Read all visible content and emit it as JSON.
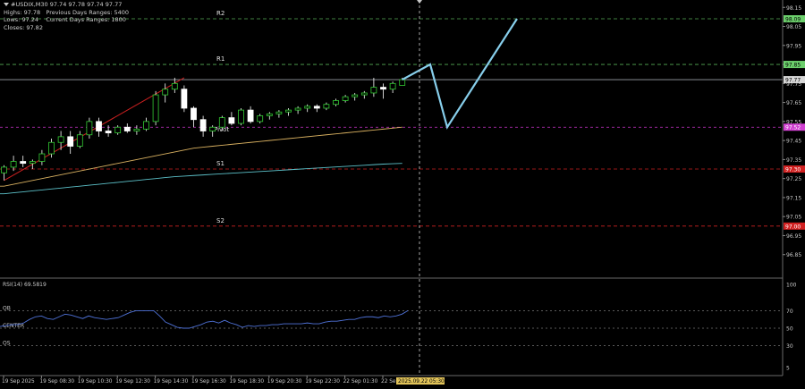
{
  "header": {
    "title": "#USDIX,M30 97.74 97.78 97.74 97.77",
    "high": "Highs: 97.78",
    "prev_range": "Previous Days Ranges: 5400",
    "low": "Lows: 97.24",
    "cur_range": "Current Days Ranges: 1800",
    "close": "Closes: 97.82"
  },
  "colors": {
    "background": "#000000",
    "bull": "#ffffff",
    "bear": "#ffffff",
    "wick": "#ffffff",
    "candle_outline": "#33cc33",
    "grid": "#3a3a3a",
    "resistance": "#55aa55",
    "support": "#cc2222",
    "pivot": "#cc33cc",
    "ma_fast": "#d8b060",
    "ma_slow": "#5cc0c8",
    "forecast": "#87ceeb",
    "rsi_line": "#4f72d8",
    "trend": "#cc2020"
  },
  "chart_data": [
    {
      "type": "candlestick",
      "symbol": "#USDIX",
      "timeframe": "M30",
      "ylim": [
        96.75,
        98.17
      ],
      "yticks": [
        98.15,
        98.05,
        97.95,
        97.85,
        97.75,
        97.65,
        97.55,
        97.45,
        97.35,
        97.25,
        97.15,
        97.05,
        96.95,
        96.85
      ],
      "xticks": [
        "19 Sep 2025",
        "19 Sep 08:30",
        "19 Sep 10:30",
        "19 Sep 12:30",
        "19 Sep 14:30",
        "19 Sep 16:30",
        "19 Sep 18:30",
        "19 Sep 20:30",
        "19 Sep 22:30",
        "22 Sep 01:30",
        "22 Se"
      ],
      "cursor_time": "2025.09.22 05:30",
      "levels": [
        {
          "name": "R2",
          "value": 98.09,
          "label": "98.09",
          "kind": "resistance"
        },
        {
          "name": "R1",
          "value": 97.85,
          "label": "97.85",
          "kind": "resistance"
        },
        {
          "name": "",
          "value": 97.77,
          "label": "97.77",
          "kind": "price"
        },
        {
          "name": "Pivot",
          "value": 97.52,
          "label": "97.52",
          "kind": "pivot"
        },
        {
          "name": "S1",
          "value": 97.3,
          "label": "97.30",
          "kind": "support"
        },
        {
          "name": "S2",
          "value": 97.0,
          "label": "97.00",
          "kind": "support"
        }
      ],
      "candles": [
        {
          "o": 97.28,
          "h": 97.32,
          "l": 97.24,
          "c": 97.31
        },
        {
          "o": 97.31,
          "h": 97.37,
          "l": 97.29,
          "c": 97.34
        },
        {
          "o": 97.34,
          "h": 97.37,
          "l": 97.31,
          "c": 97.33
        },
        {
          "o": 97.33,
          "h": 97.35,
          "l": 97.3,
          "c": 97.34
        },
        {
          "o": 97.34,
          "h": 97.4,
          "l": 97.32,
          "c": 97.38
        },
        {
          "o": 97.38,
          "h": 97.46,
          "l": 97.36,
          "c": 97.44
        },
        {
          "o": 97.44,
          "h": 97.5,
          "l": 97.4,
          "c": 97.47
        },
        {
          "o": 97.47,
          "h": 97.5,
          "l": 97.38,
          "c": 97.42
        },
        {
          "o": 97.42,
          "h": 97.5,
          "l": 97.41,
          "c": 97.48
        },
        {
          "o": 97.48,
          "h": 97.57,
          "l": 97.46,
          "c": 97.55
        },
        {
          "o": 97.55,
          "h": 97.57,
          "l": 97.47,
          "c": 97.5
        },
        {
          "o": 97.5,
          "h": 97.53,
          "l": 97.47,
          "c": 97.49
        },
        {
          "o": 97.49,
          "h": 97.53,
          "l": 97.48,
          "c": 97.52
        },
        {
          "o": 97.52,
          "h": 97.54,
          "l": 97.49,
          "c": 97.5
        },
        {
          "o": 97.5,
          "h": 97.53,
          "l": 97.48,
          "c": 97.51
        },
        {
          "o": 97.51,
          "h": 97.57,
          "l": 97.5,
          "c": 97.55
        },
        {
          "o": 97.55,
          "h": 97.71,
          "l": 97.53,
          "c": 97.69
        },
        {
          "o": 97.69,
          "h": 97.75,
          "l": 97.65,
          "c": 97.72
        },
        {
          "o": 97.72,
          "h": 97.78,
          "l": 97.7,
          "c": 97.75
        },
        {
          "o": 97.72,
          "h": 97.74,
          "l": 97.6,
          "c": 97.62
        },
        {
          "o": 97.62,
          "h": 97.63,
          "l": 97.52,
          "c": 97.56
        },
        {
          "o": 97.56,
          "h": 97.58,
          "l": 97.47,
          "c": 97.5
        },
        {
          "o": 97.5,
          "h": 97.53,
          "l": 97.47,
          "c": 97.52
        },
        {
          "o": 97.52,
          "h": 97.58,
          "l": 97.5,
          "c": 97.57
        },
        {
          "o": 97.57,
          "h": 97.6,
          "l": 97.53,
          "c": 97.54
        },
        {
          "o": 97.54,
          "h": 97.62,
          "l": 97.53,
          "c": 97.61
        },
        {
          "o": 97.61,
          "h": 97.63,
          "l": 97.54,
          "c": 97.55
        },
        {
          "o": 97.55,
          "h": 97.59,
          "l": 97.54,
          "c": 97.58
        },
        {
          "o": 97.58,
          "h": 97.6,
          "l": 97.56,
          "c": 97.59
        },
        {
          "o": 97.59,
          "h": 97.61,
          "l": 97.57,
          "c": 97.6
        },
        {
          "o": 97.6,
          "h": 97.62,
          "l": 97.58,
          "c": 97.61
        },
        {
          "o": 97.61,
          "h": 97.63,
          "l": 97.59,
          "c": 97.62
        },
        {
          "o": 97.62,
          "h": 97.64,
          "l": 97.6,
          "c": 97.63
        },
        {
          "o": 97.63,
          "h": 97.64,
          "l": 97.6,
          "c": 97.62
        },
        {
          "o": 97.62,
          "h": 97.65,
          "l": 97.61,
          "c": 97.64
        },
        {
          "o": 97.64,
          "h": 97.67,
          "l": 97.63,
          "c": 97.66
        },
        {
          "o": 97.66,
          "h": 97.69,
          "l": 97.65,
          "c": 97.68
        },
        {
          "o": 97.68,
          "h": 97.7,
          "l": 97.66,
          "c": 97.69
        },
        {
          "o": 97.69,
          "h": 97.71,
          "l": 97.67,
          "c": 97.7
        },
        {
          "o": 97.7,
          "h": 97.78,
          "l": 97.68,
          "c": 97.73
        },
        {
          "o": 97.73,
          "h": 97.75,
          "l": 97.67,
          "c": 97.72
        },
        {
          "o": 97.72,
          "h": 97.76,
          "l": 97.7,
          "c": 97.75
        },
        {
          "o": 97.74,
          "h": 97.78,
          "l": 97.74,
          "c": 97.77
        }
      ],
      "ma_fast": [
        97.21,
        97.22,
        97.23,
        97.24,
        97.25,
        97.26,
        97.27,
        97.28,
        97.29,
        97.3,
        97.31,
        97.32,
        97.33,
        97.34,
        97.35,
        97.36,
        97.37,
        97.38,
        97.39,
        97.4,
        97.41,
        97.415,
        97.42,
        97.425,
        97.43,
        97.435,
        97.44,
        97.445,
        97.45,
        97.455,
        97.46,
        97.465,
        97.47,
        97.475,
        97.48,
        97.485,
        97.49,
        97.495,
        97.5,
        97.505,
        97.51,
        97.515,
        97.52
      ],
      "ma_slow": [
        97.17,
        97.175,
        97.18,
        97.185,
        97.19,
        97.195,
        97.2,
        97.205,
        97.21,
        97.215,
        97.22,
        97.225,
        97.23,
        97.235,
        97.24,
        97.245,
        97.25,
        97.255,
        97.26,
        97.263,
        97.266,
        97.269,
        97.272,
        97.275,
        97.278,
        97.281,
        97.284,
        97.287,
        97.29,
        97.293,
        97.296,
        97.299,
        97.302,
        97.305,
        97.308,
        97.311,
        97.314,
        97.317,
        97.32,
        97.323,
        97.326,
        97.328,
        97.33
      ],
      "trend_line": {
        "from_index": 0,
        "from": 97.24,
        "to_index": 19,
        "to": 97.78
      },
      "forecast_path": [
        {
          "step": 0,
          "value": 97.77
        },
        {
          "step": 1,
          "value": 97.85
        },
        {
          "step": 2,
          "value": 97.52
        },
        {
          "step": 3,
          "value": 98.09
        }
      ]
    },
    {
      "type": "line",
      "title": "RSI(14) 69.5819",
      "ylim": [
        0,
        100
      ],
      "yticks": [
        100,
        70,
        50,
        30,
        5
      ],
      "levels": [
        {
          "name": "OB",
          "value": 70
        },
        {
          "name": "CENTER",
          "value": 50
        },
        {
          "name": "OS",
          "value": 30
        }
      ],
      "values": [
        52,
        53,
        54,
        54,
        56,
        60,
        63,
        64,
        61,
        60,
        63,
        66,
        65,
        63,
        61,
        64,
        62,
        61,
        60,
        61,
        62,
        65,
        68,
        70,
        70,
        70,
        70,
        64,
        57,
        54,
        51,
        50,
        50,
        52,
        54,
        57,
        58,
        56,
        59,
        56,
        54,
        51,
        53,
        52,
        53,
        53,
        54,
        54,
        55,
        55,
        55,
        55,
        56,
        55,
        55,
        57,
        58,
        58,
        59,
        60,
        60,
        62,
        63,
        63,
        62,
        64,
        63,
        64,
        66,
        70
      ]
    }
  ]
}
